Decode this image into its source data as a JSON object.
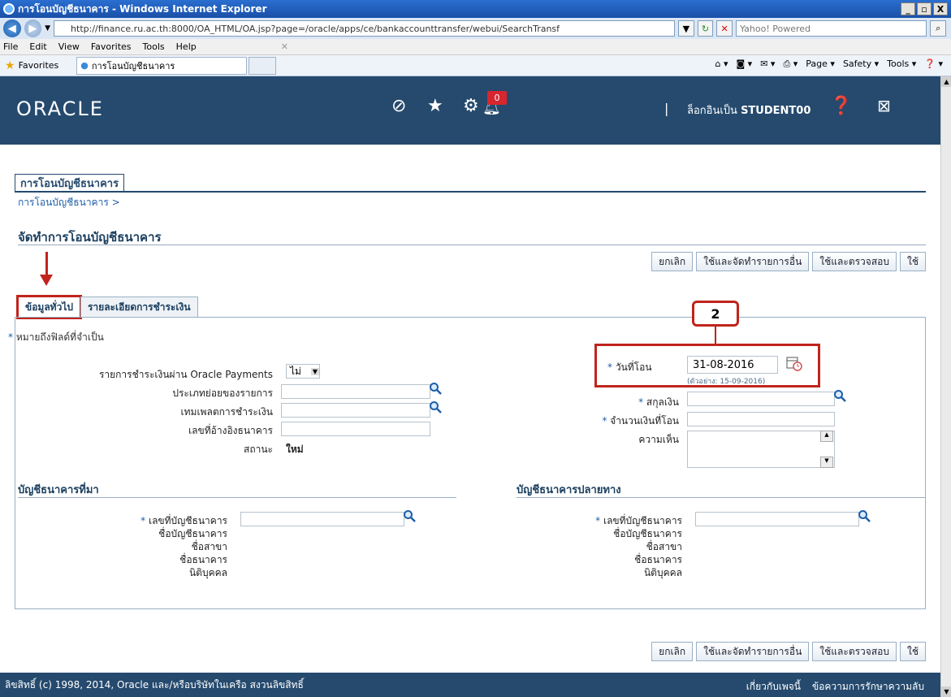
{
  "window": {
    "title": "การโอนบัญชีธนาคาร - Windows Internet Explorer",
    "min": "_",
    "max": "▫",
    "close": "X"
  },
  "address": {
    "url": "http://finance.ru.ac.th:8000/OA_HTML/OA.jsp?page=/oracle/apps/ce/bankaccounttransfer/webui/SearchTransf",
    "search_placeholder": "Yahoo! Powered"
  },
  "menu": [
    "File",
    "Edit",
    "View",
    "Favorites",
    "Tools",
    "Help"
  ],
  "favorites": {
    "label": "Favorites",
    "tab_title": "การโอนบัญชีธนาคาร"
  },
  "commands": [
    "Page ▾",
    "Safety ▾",
    "Tools ▾"
  ],
  "header": {
    "logo": "ORACLE",
    "notification_count": "0",
    "separator": "|",
    "logged_in_prefix": "ล็อกอินเป็น",
    "username": "STUDENT00"
  },
  "page": {
    "tab": "การโอนบัญชีธนาคาร",
    "breadcrumb": "การโอนบัญชีธนาคาร >",
    "title": "จัดทำการโอนบัญชีธนาคาร"
  },
  "buttons": {
    "cancel": "ยกเลิก",
    "apply_create_another": "ใช้และจัดทำรายการอื่น",
    "apply_validate": "ใช้และตรวจสอบ",
    "apply": "ใช้"
  },
  "subtabs": [
    "ข้อมูลทั่วไป",
    "รายละเอียดการชำระเงิน"
  ],
  "callout_number": "2",
  "form": {
    "required_note": "หมายถึงฟิลด์ที่จำเป็น",
    "oracle_payments_label": "รายการชำระเงินผ่าน Oracle Payments",
    "oracle_payments_value": "ไม่",
    "subtype_label": "ประเภทย่อยของรายการ",
    "template_label": "เทมเพลตการชำระเงิน",
    "bank_ref_label": "เลขที่อ้างอิงธนาคาร",
    "status_label": "สถานะ",
    "status_value": "ใหม่",
    "transfer_date_label": "วันที่โอน",
    "transfer_date_value": "31-08-2016",
    "transfer_date_hint": "(ตัวอย่าง: 15-09-2016)",
    "currency_label": "สกุลเงิน",
    "amount_label": "จำนวนเงินที่โอน",
    "comment_label": "ความเห็น"
  },
  "source_account": {
    "heading": "บัญชีธนาคารที่มา",
    "account_no_label": "เลขที่บัญชีธนาคาร",
    "account_name_label": "ชื่อบัญชีธนาคาร",
    "branch_label": "ชื่อสาขา",
    "bank_label": "ชื่อธนาคาร",
    "entity_label": "นิติบุคคล"
  },
  "dest_account": {
    "heading": "บัญชีธนาคารปลายทาง",
    "account_no_label": "เลขที่บัญชีธนาคาร",
    "account_name_label": "ชื่อบัญชีธนาคาร",
    "branch_label": "ชื่อสาขา",
    "bank_label": "ชื่อธนาคาร",
    "entity_label": "นิติบุคคล"
  },
  "footer": {
    "copyright": "ลิขสิทธิ์ (c) 1998, 2014, Oracle และ/หรือบริษัทในเครือ สงวนลิขสิทธิ์",
    "about_page": "เกี่ยวกับเพจนี้",
    "privacy": "ข้อความการรักษาความลับ"
  },
  "colors": {
    "header_bg": "#254a6e",
    "annotation_red": "#c0241c",
    "link": "#1f5fa8"
  }
}
